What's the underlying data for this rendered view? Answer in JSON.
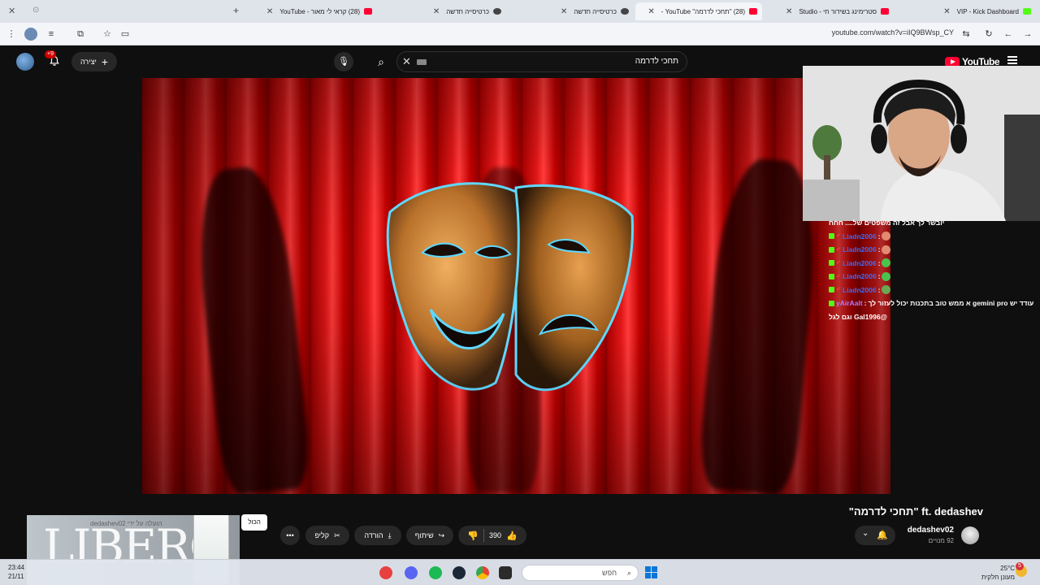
{
  "browser": {
    "tabs": [
      {
        "label": "VIP - Kick Dashboard",
        "icon": "kick-icon"
      },
      {
        "label": "סטרימינג בשידור חי - Studio",
        "icon": "youtube-icon"
      },
      {
        "label": "(28) \"תחכי לדרמה\" YouTube -",
        "icon": "youtube-icon",
        "active": true
      },
      {
        "label": "כרטיסייה חדשה",
        "icon": "chrome-icon"
      },
      {
        "label": "כרטיסייה חדשה",
        "icon": "chrome-icon"
      },
      {
        "label": "(28) קראי לי מאור - YouTube",
        "icon": "youtube-icon"
      }
    ],
    "url": "youtube.com/watch?v=iIQ9BWsp_CY"
  },
  "youtube": {
    "logo_text": "YouTube",
    "search_query": "תחכי לדרמה",
    "create_label": "יצירה",
    "notification_count": "+9",
    "video": {
      "title": "\"תחכי לדרמה\" ft. dedashev",
      "channel": "dedashev02",
      "subscribers": "92 מנויים",
      "likes": "390",
      "share_label": "שיתוף",
      "download_label": "הורדה",
      "clip_label": "קליפ",
      "more_label": "•••"
    },
    "tooltip_all": "הכול",
    "notification_popup": {
      "brand": "LIBERO",
      "text": "הועלה על ידי dedashev02"
    }
  },
  "chat": [
    {
      "user": "",
      "text": "יובשר לך אבל זה משפטים של.... חחח"
    },
    {
      "user": "Liadn2006",
      "text": ""
    },
    {
      "user": "Liadn2006",
      "text": ""
    },
    {
      "user": "Liadn2006",
      "text": ""
    },
    {
      "user": "Liadn2006",
      "text": ""
    },
    {
      "user": "Liadn2006",
      "text": ""
    },
    {
      "user": "yAirAalt",
      "text": "עודד יש gemini pro א ממש טוב בתכנות יכול לעזור לך"
    },
    {
      "user": "",
      "text": "@Gal1996 וגם לגל"
    }
  ],
  "taskbar": {
    "time": "23:44",
    "date": "21/11",
    "search_placeholder": "חפש",
    "weather_temp": "25°C",
    "weather_desc": "מעונן חלקית",
    "weather_badge": "5"
  }
}
